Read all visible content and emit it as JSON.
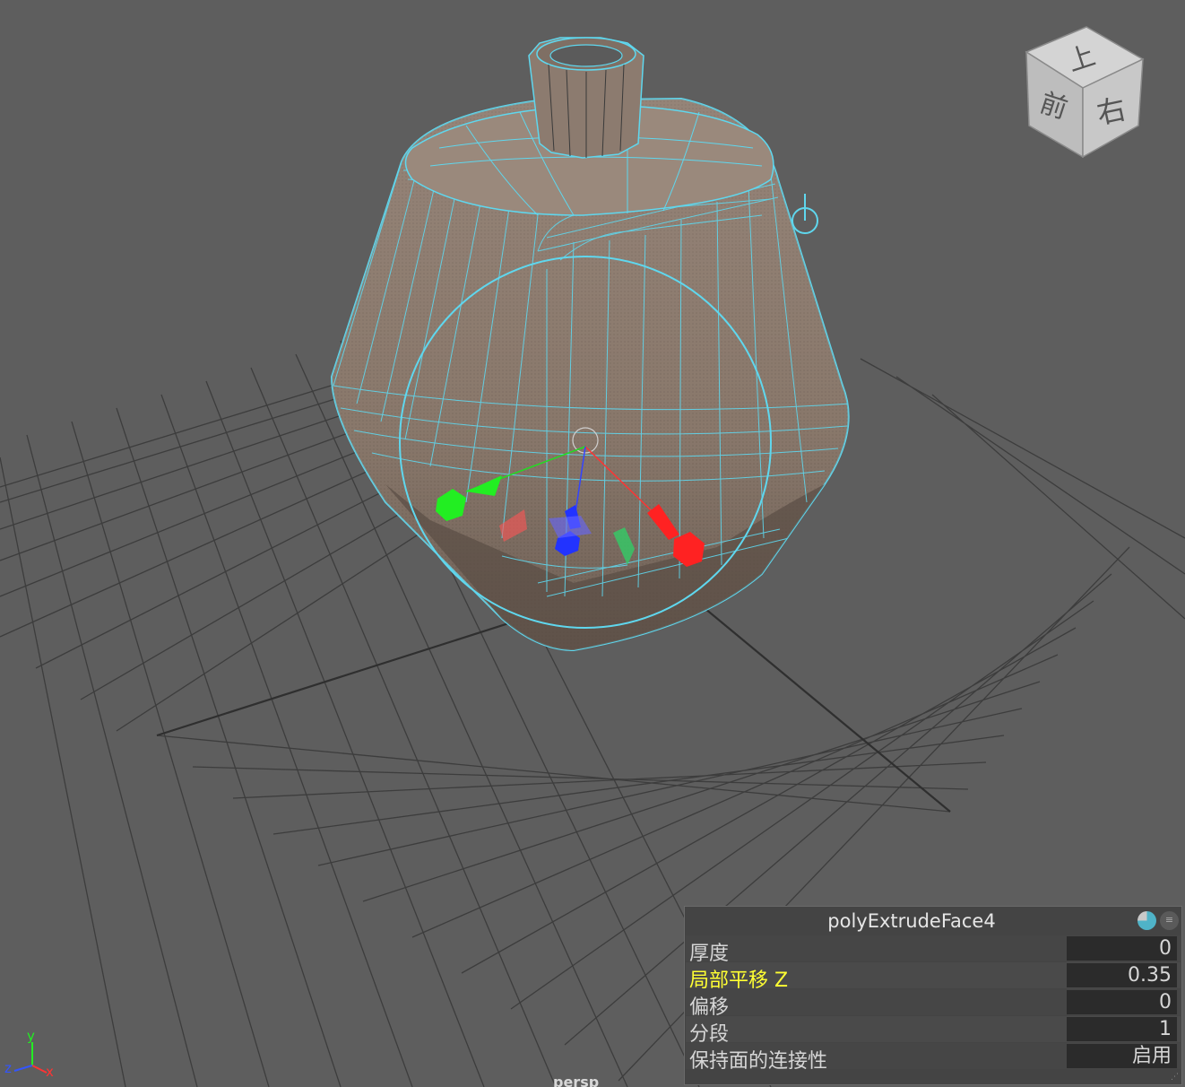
{
  "viewport": {
    "camera_label": "persp",
    "background": "#5e5e5e",
    "grid_color": "#3c3c3c",
    "wireframe_color": "#5fd7ee",
    "mesh_color": "#8e7d72"
  },
  "view_cube": {
    "top_face": "上",
    "front_face": "前",
    "right_face": "右"
  },
  "axis_indicator": {
    "x": "x",
    "y": "y",
    "z": "z"
  },
  "channel_box": {
    "node_name": "polyExtrudeFace4",
    "attributes": [
      {
        "label": "厚度",
        "value": "0"
      },
      {
        "label": "局部平移 Z",
        "value": "0.35"
      },
      {
        "label": "偏移",
        "value": "0"
      },
      {
        "label": "分段",
        "value": "1"
      },
      {
        "label": "保持面的连接性",
        "value": "启用"
      }
    ]
  }
}
